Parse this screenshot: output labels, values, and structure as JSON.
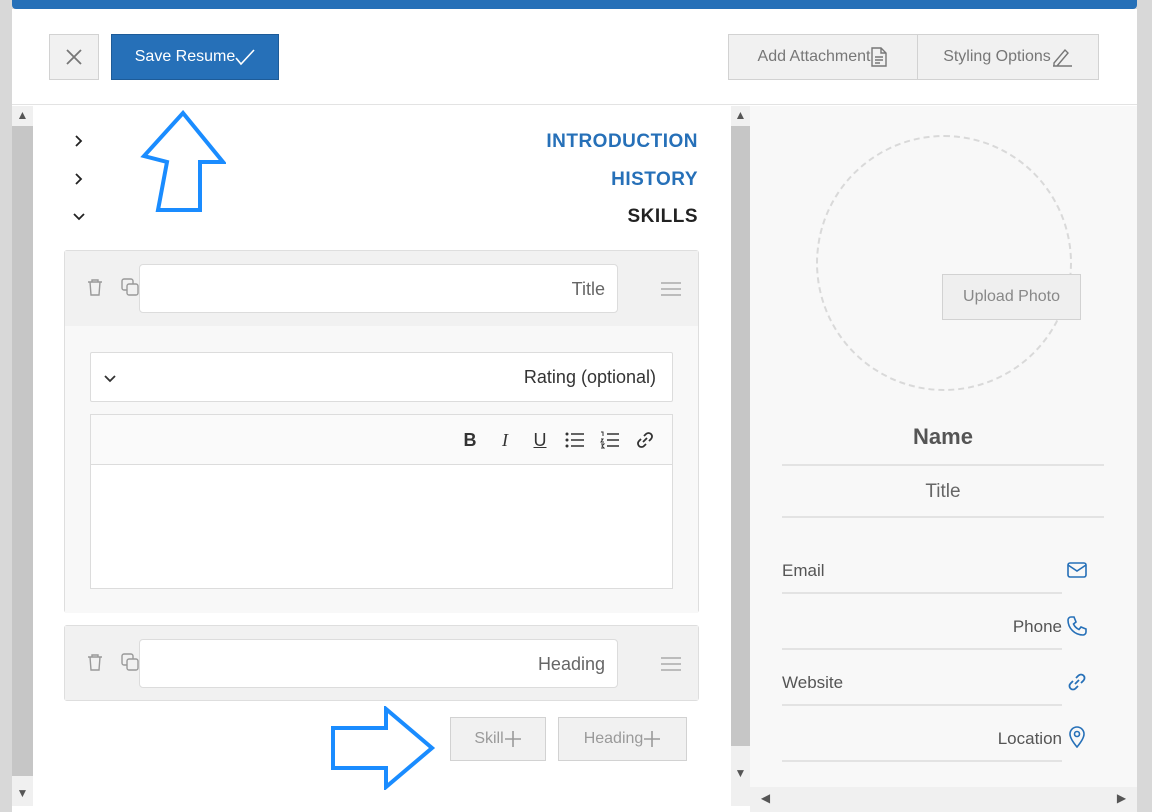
{
  "toolbar": {
    "save_label": "Save Resume",
    "attach_label": "Add Attachment",
    "styling_label": "Styling Options"
  },
  "sections": [
    {
      "label": "INTRODUCTION",
      "expanded": false
    },
    {
      "label": "HISTORY",
      "expanded": false
    },
    {
      "label": "SKILLS",
      "expanded": true
    }
  ],
  "skill_card": {
    "title_placeholder": "Title",
    "rating_label": "Rating (optional)",
    "format_tools": [
      "B",
      "I",
      "U"
    ]
  },
  "heading_card": {
    "title_placeholder": "Heading"
  },
  "add_buttons": {
    "skill_label": "Skill",
    "heading_label": "Heading"
  },
  "profile": {
    "upload_label": "Upload Photo",
    "name": "Name",
    "title": "Title",
    "contacts": [
      {
        "label": "Email",
        "icon": "mail-icon",
        "align": "left"
      },
      {
        "label": "Phone",
        "icon": "phone-icon",
        "align": "right"
      },
      {
        "label": "Website",
        "icon": "link-icon",
        "align": "left"
      },
      {
        "label": "Location",
        "icon": "location-icon",
        "align": "right"
      }
    ]
  },
  "colors": {
    "accent": "#2670b8",
    "highlight_arrow": "#1a8cff"
  }
}
